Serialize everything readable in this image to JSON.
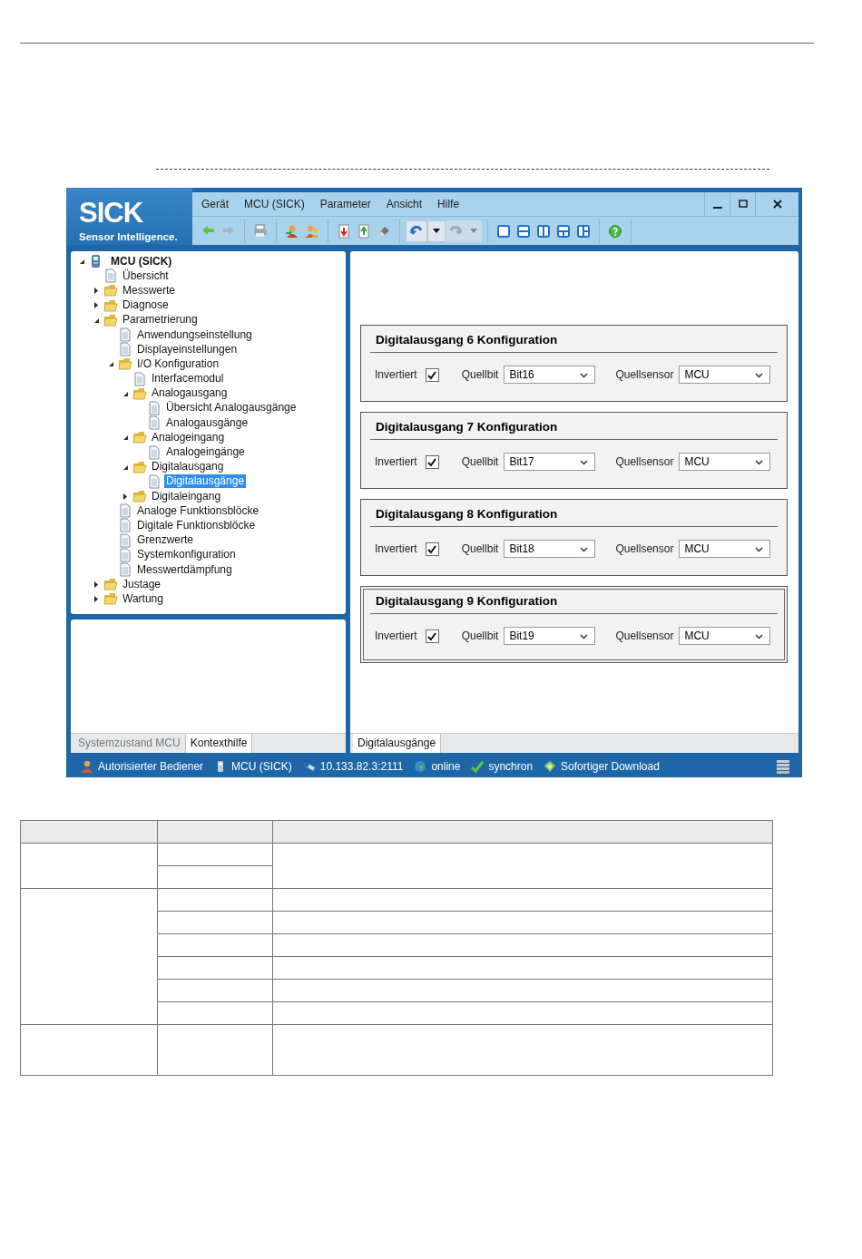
{
  "window": {
    "logo": {
      "brand": "SICK",
      "tagline": "Sensor Intelligence."
    },
    "menu": [
      "Gerät",
      "MCU (SICK)",
      "Parameter",
      "Ansicht",
      "Hilfe"
    ],
    "tree": [
      {
        "label": "MCU (SICK)",
        "kind": "device",
        "expanded": true,
        "selected": false,
        "children": [
          {
            "label": "Übersicht",
            "kind": "page",
            "selected": false
          },
          {
            "label": "Messwerte",
            "kind": "folder",
            "expanded": false,
            "selected": false
          },
          {
            "label": "Diagnose",
            "kind": "folder",
            "expanded": false,
            "selected": false
          },
          {
            "label": "Parametrierung",
            "kind": "folder",
            "expanded": true,
            "selected": false,
            "children": [
              {
                "label": "Anwendungseinstellung",
                "kind": "page",
                "selected": false
              },
              {
                "label": "Displayeinstellungen",
                "kind": "page",
                "selected": false
              },
              {
                "label": "I/O Konfiguration",
                "kind": "folder",
                "expanded": true,
                "selected": false,
                "children": [
                  {
                    "label": "Interfacemodul",
                    "kind": "page",
                    "selected": false
                  },
                  {
                    "label": "Analogausgang",
                    "kind": "folder",
                    "expanded": true,
                    "selected": false,
                    "children": [
                      {
                        "label": "Übersicht Analogausgänge",
                        "kind": "page",
                        "selected": false
                      },
                      {
                        "label": "Analogausgänge",
                        "kind": "page",
                        "selected": false
                      }
                    ]
                  },
                  {
                    "label": "Analogeingang",
                    "kind": "folder",
                    "expanded": true,
                    "selected": false,
                    "children": [
                      {
                        "label": "Analogeingänge",
                        "kind": "page",
                        "selected": false
                      }
                    ]
                  },
                  {
                    "label": "Digitalausgang",
                    "kind": "folder",
                    "expanded": true,
                    "selected": false,
                    "children": [
                      {
                        "label": "Digitalausgänge",
                        "kind": "page",
                        "selected": true
                      }
                    ]
                  },
                  {
                    "label": "Digitaleingang",
                    "kind": "folder",
                    "expanded": false,
                    "selected": false
                  }
                ]
              },
              {
                "label": "Analoge Funktionsblöcke",
                "kind": "page",
                "selected": false
              },
              {
                "label": "Digitale Funktionsblöcke",
                "kind": "page",
                "selected": false
              },
              {
                "label": "Grenzwerte",
                "kind": "page",
                "selected": false
              },
              {
                "label": "Systemkonfiguration",
                "kind": "page",
                "selected": false
              },
              {
                "label": "Messwertdämpfung",
                "kind": "page",
                "selected": false
              }
            ]
          },
          {
            "label": "Justage",
            "kind": "folder",
            "expanded": false,
            "selected": false
          },
          {
            "label": "Wartung",
            "kind": "folder",
            "expanded": false,
            "selected": false
          }
        ]
      }
    ],
    "side_tabs": [
      {
        "label": "Systemzustand MCU",
        "selected": false
      },
      {
        "label": "Kontexthilfe",
        "selected": true
      }
    ],
    "groups": [
      {
        "title": "Digitalausgang 6 Konfiguration",
        "inverted_label": "Invertiert",
        "inverted": true,
        "source_bit_label": "Quellbit",
        "source_bit": "Bit16",
        "source_sensor_label": "Quellsensor",
        "source_sensor": "MCU",
        "focused": false
      },
      {
        "title": "Digitalausgang 7 Konfiguration",
        "inverted_label": "Invertiert",
        "inverted": true,
        "source_bit_label": "Quellbit",
        "source_bit": "Bit17",
        "source_sensor_label": "Quellsensor",
        "source_sensor": "MCU",
        "focused": false
      },
      {
        "title": "Digitalausgang 8 Konfiguration",
        "inverted_label": "Invertiert",
        "inverted": true,
        "source_bit_label": "Quellbit",
        "source_bit": "Bit18",
        "source_sensor_label": "Quellsensor",
        "source_sensor": "MCU",
        "focused": false
      },
      {
        "title": "Digitalausgang 9 Konfiguration",
        "inverted_label": "Invertiert",
        "inverted": true,
        "source_bit_label": "Quellbit",
        "source_bit": "Bit19",
        "source_sensor_label": "Quellsensor",
        "source_sensor": "MCU",
        "focused": true
      }
    ],
    "content_tabs": [
      {
        "label": "Digitalausgänge",
        "selected": true
      }
    ],
    "status_bar": [
      {
        "kind": "user",
        "text": "Autorisierter Bediener"
      },
      {
        "kind": "device",
        "text": "MCU (SICK)"
      },
      {
        "kind": "network",
        "text": "10.133.82.3:2111"
      },
      {
        "kind": "globe",
        "text": "online"
      },
      {
        "kind": "check",
        "text": "synchron"
      },
      {
        "kind": "download",
        "text": "Sofortiger Download"
      }
    ]
  }
}
